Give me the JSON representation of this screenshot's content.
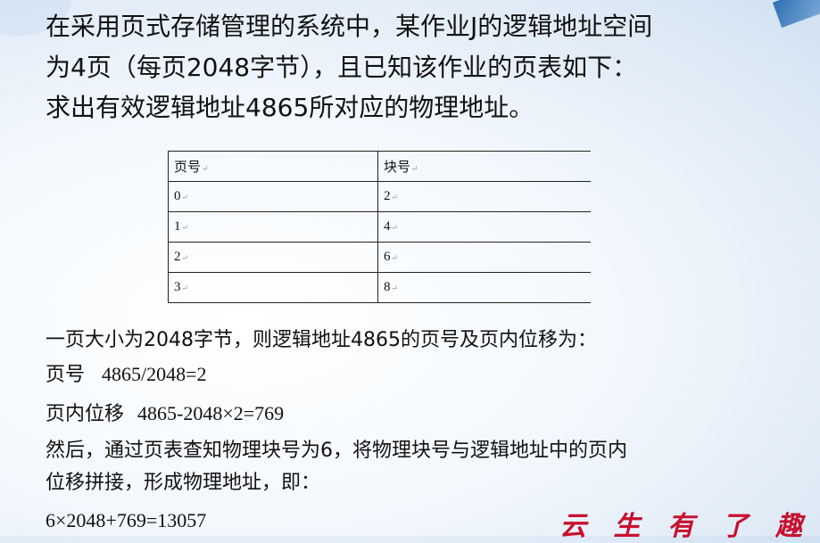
{
  "question": {
    "line1": "在采用页式存储管理的系统中，某作业J的逻辑地址空间",
    "line2": "为4页（每页2048字节），且已知该作业的页表如下：",
    "line3": "求出有效逻辑地址4865所对应的物理地址。"
  },
  "page_table": {
    "headers": [
      "页号",
      "块号"
    ],
    "rows": [
      [
        "0",
        "2"
      ],
      [
        "1",
        "4"
      ],
      [
        "2",
        "6"
      ],
      [
        "3",
        "8"
      ]
    ],
    "cell_mark": "↵"
  },
  "solution": {
    "line1": "一页大小为2048字节，则逻辑地址4865的页号及页内位移为：",
    "page_label": "页号",
    "page_calc": "4865/2048=2",
    "offset_label": "页内位移",
    "offset_calc": "4865-2048×2=769",
    "line4": "然后，通过页表查知物理块号为6，将物理块号与逻辑地址中的页内",
    "line5": "位移拼接，形成物理地址，即：",
    "result": "6×2048+769=13057"
  },
  "watermark": "云 生 有 了 趣"
}
